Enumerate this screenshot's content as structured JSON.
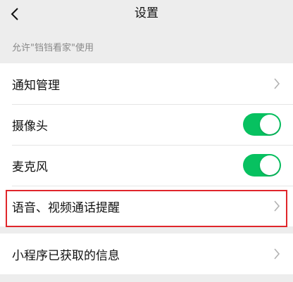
{
  "nav": {
    "title": "设置",
    "back_icon": "chevron-left-icon"
  },
  "section": {
    "caption": "允许\"铛铛看家\"使用"
  },
  "settings": {
    "notification": {
      "label": "通知管理"
    },
    "camera": {
      "label": "摄像头",
      "enabled": true
    },
    "microphone": {
      "label": "麦克风",
      "enabled": true
    },
    "call_reminder": {
      "label": "语音、视频通话提醒"
    }
  },
  "info": {
    "label": "小程序已获取的信息"
  },
  "colors": {
    "toggle_on": "#07c160",
    "highlight": "#e0262b",
    "background": "#ededed"
  }
}
